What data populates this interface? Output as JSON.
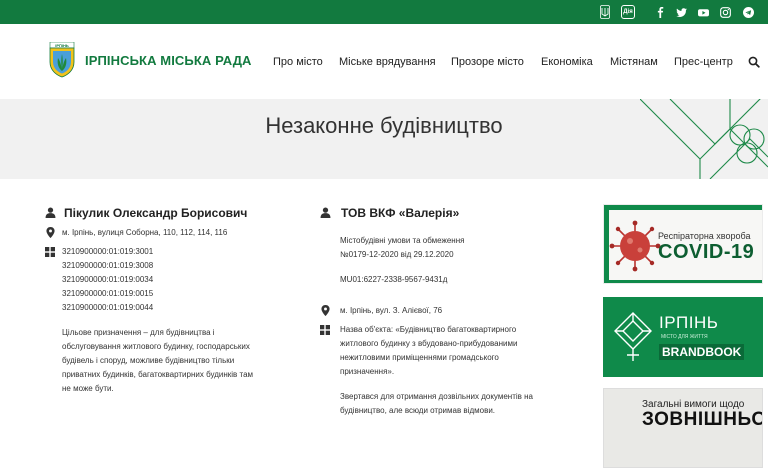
{
  "topbar": {
    "diia_label": "Дія",
    "social": [
      "facebook-icon",
      "twitter-icon",
      "youtube-icon",
      "instagram-icon",
      "telegram-icon"
    ]
  },
  "header": {
    "brand": "ІРПІНСЬКА МІСЬКА РАДА",
    "logo_text": "ІРПІНЬ",
    "nav": [
      "Про місто",
      "Міське врядування",
      "Прозоре місто",
      "Економіка",
      "Містянам",
      "Прес-центр"
    ]
  },
  "hero": {
    "title": "Незаконне будівництво"
  },
  "left": {
    "name": "Пікулик Олександр Борисович",
    "address": "м. Ірпінь, вулиця Соборна, 110, 112, 114, 116",
    "cadastral": [
      "3210900000:01:019:3001",
      "3210900000:01:019:3008",
      "3210900000:01:019:0034",
      "3210900000:01:019:0015",
      "3210900000:01:019:0044"
    ],
    "description": [
      "Цільове призначення – для будівництва і",
      "обслуговування житлового будинку, господарських",
      "будівель і споруд, можливе будівництво тільки",
      "приватних будинків, багатоквартирних будинків там",
      "не може бути."
    ]
  },
  "right": {
    "name": "ТОВ ВКФ «Валерія»",
    "conditions": [
      "Містобудівні умови та обмеження",
      "№0179-12-2020 від 29.12.2020"
    ],
    "mu": "MU01:6227-2338-9567-9431д",
    "address": "м. Ірпінь, вул. З. Алієвої, 76",
    "object": [
      "Назва об'єкта: «Будівництво багатоквартирного",
      "житлового будинку з вбудовано-прибудованими",
      "нежитловими приміщеннями громадського",
      "призначення»."
    ],
    "appeal": [
      "Звертався для отримання дозвільних документів на",
      "будівництво, але всюди отримав відмови."
    ]
  },
  "banners": {
    "covid": {
      "line1": "Респіраторна хвороба",
      "line2": "COVID-19"
    },
    "brand": {
      "line1": "ІРПІНЬ",
      "sub": "МІСТО ДЛЯ ЖИТТЯ",
      "line2": "BRANDBOOK"
    },
    "rules": {
      "line1": "Загальні вимоги щодо",
      "line2": "ЗОВНІШНЬОЇ"
    }
  },
  "colors": {
    "brand_green": "#127a3f",
    "hero_bg": "#f1f1f1"
  }
}
